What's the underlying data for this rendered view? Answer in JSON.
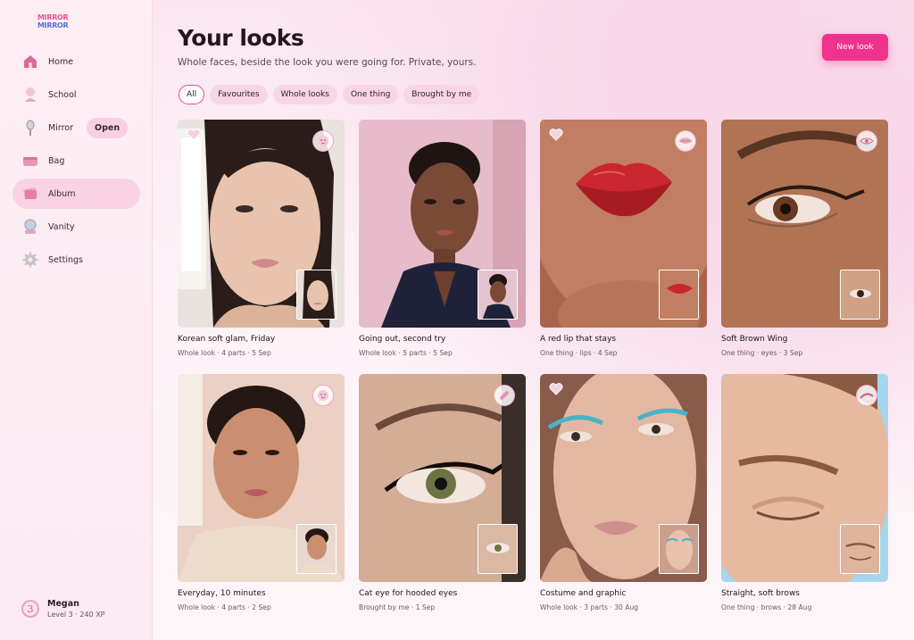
{
  "app": {
    "logo_line1": "MIRROR",
    "logo_line2": "MIRROR"
  },
  "sidebar": {
    "items": [
      {
        "label": "Home",
        "icon": "home-icon"
      },
      {
        "label": "School",
        "icon": "school-icon"
      },
      {
        "label": "Mirror",
        "icon": "hand-mirror-icon",
        "pill": "Open"
      },
      {
        "label": "Bag",
        "icon": "makeup-bag-icon"
      },
      {
        "label": "Album",
        "icon": "album-icon",
        "active": true
      },
      {
        "label": "Vanity",
        "icon": "vanity-icon"
      },
      {
        "label": "Settings",
        "icon": "gear-icon"
      }
    ]
  },
  "user": {
    "avatar_text": "3",
    "name": "Megan",
    "level": "Level 3 · 240 XP"
  },
  "header": {
    "title": "Your looks",
    "subtitle": "Whole faces, beside the look you were going for. Private, yours.",
    "new_look_label": "New look"
  },
  "filters": [
    {
      "label": "All",
      "active": true
    },
    {
      "label": "Favourites"
    },
    {
      "label": "Whole looks"
    },
    {
      "label": "One thing"
    },
    {
      "label": "Brought by me"
    }
  ],
  "looks": [
    {
      "title": "Korean soft glam, Friday",
      "meta": "Whole look · 4 parts · 5 Sep",
      "badge": "face-icon",
      "favourite": true
    },
    {
      "title": "Going out, second try",
      "meta": "Whole look · 5 parts · 5 Sep",
      "badge": "",
      "favourite": false
    },
    {
      "title": "A red lip that stays",
      "meta": "One thing · lips · 4 Sep",
      "badge": "lips-icon",
      "favourite": true
    },
    {
      "title": "Soft Brown Wing",
      "meta": "One thing · eyes · 3 Sep",
      "badge": "eye-icon",
      "favourite": false
    },
    {
      "title": "Everyday, 10 minutes",
      "meta": "Whole look · 4 parts · 2 Sep",
      "badge": "face-icon",
      "favourite": false
    },
    {
      "title": "Cat eye for hooded eyes",
      "meta": "Brought by me · 1 Sep",
      "badge": "brush-icon",
      "favourite": false
    },
    {
      "title": "Costume and graphic",
      "meta": "Whole look · 3 parts · 30 Aug",
      "badge": "",
      "favourite": true
    },
    {
      "title": "Straight, soft brows",
      "meta": "One thing · brows · 28 Aug",
      "badge": "brow-icon",
      "favourite": false
    }
  ],
  "colors": {
    "accent": "#f0328c",
    "chip": "#f9d6e4",
    "active_nav": "#f9d3e4"
  }
}
